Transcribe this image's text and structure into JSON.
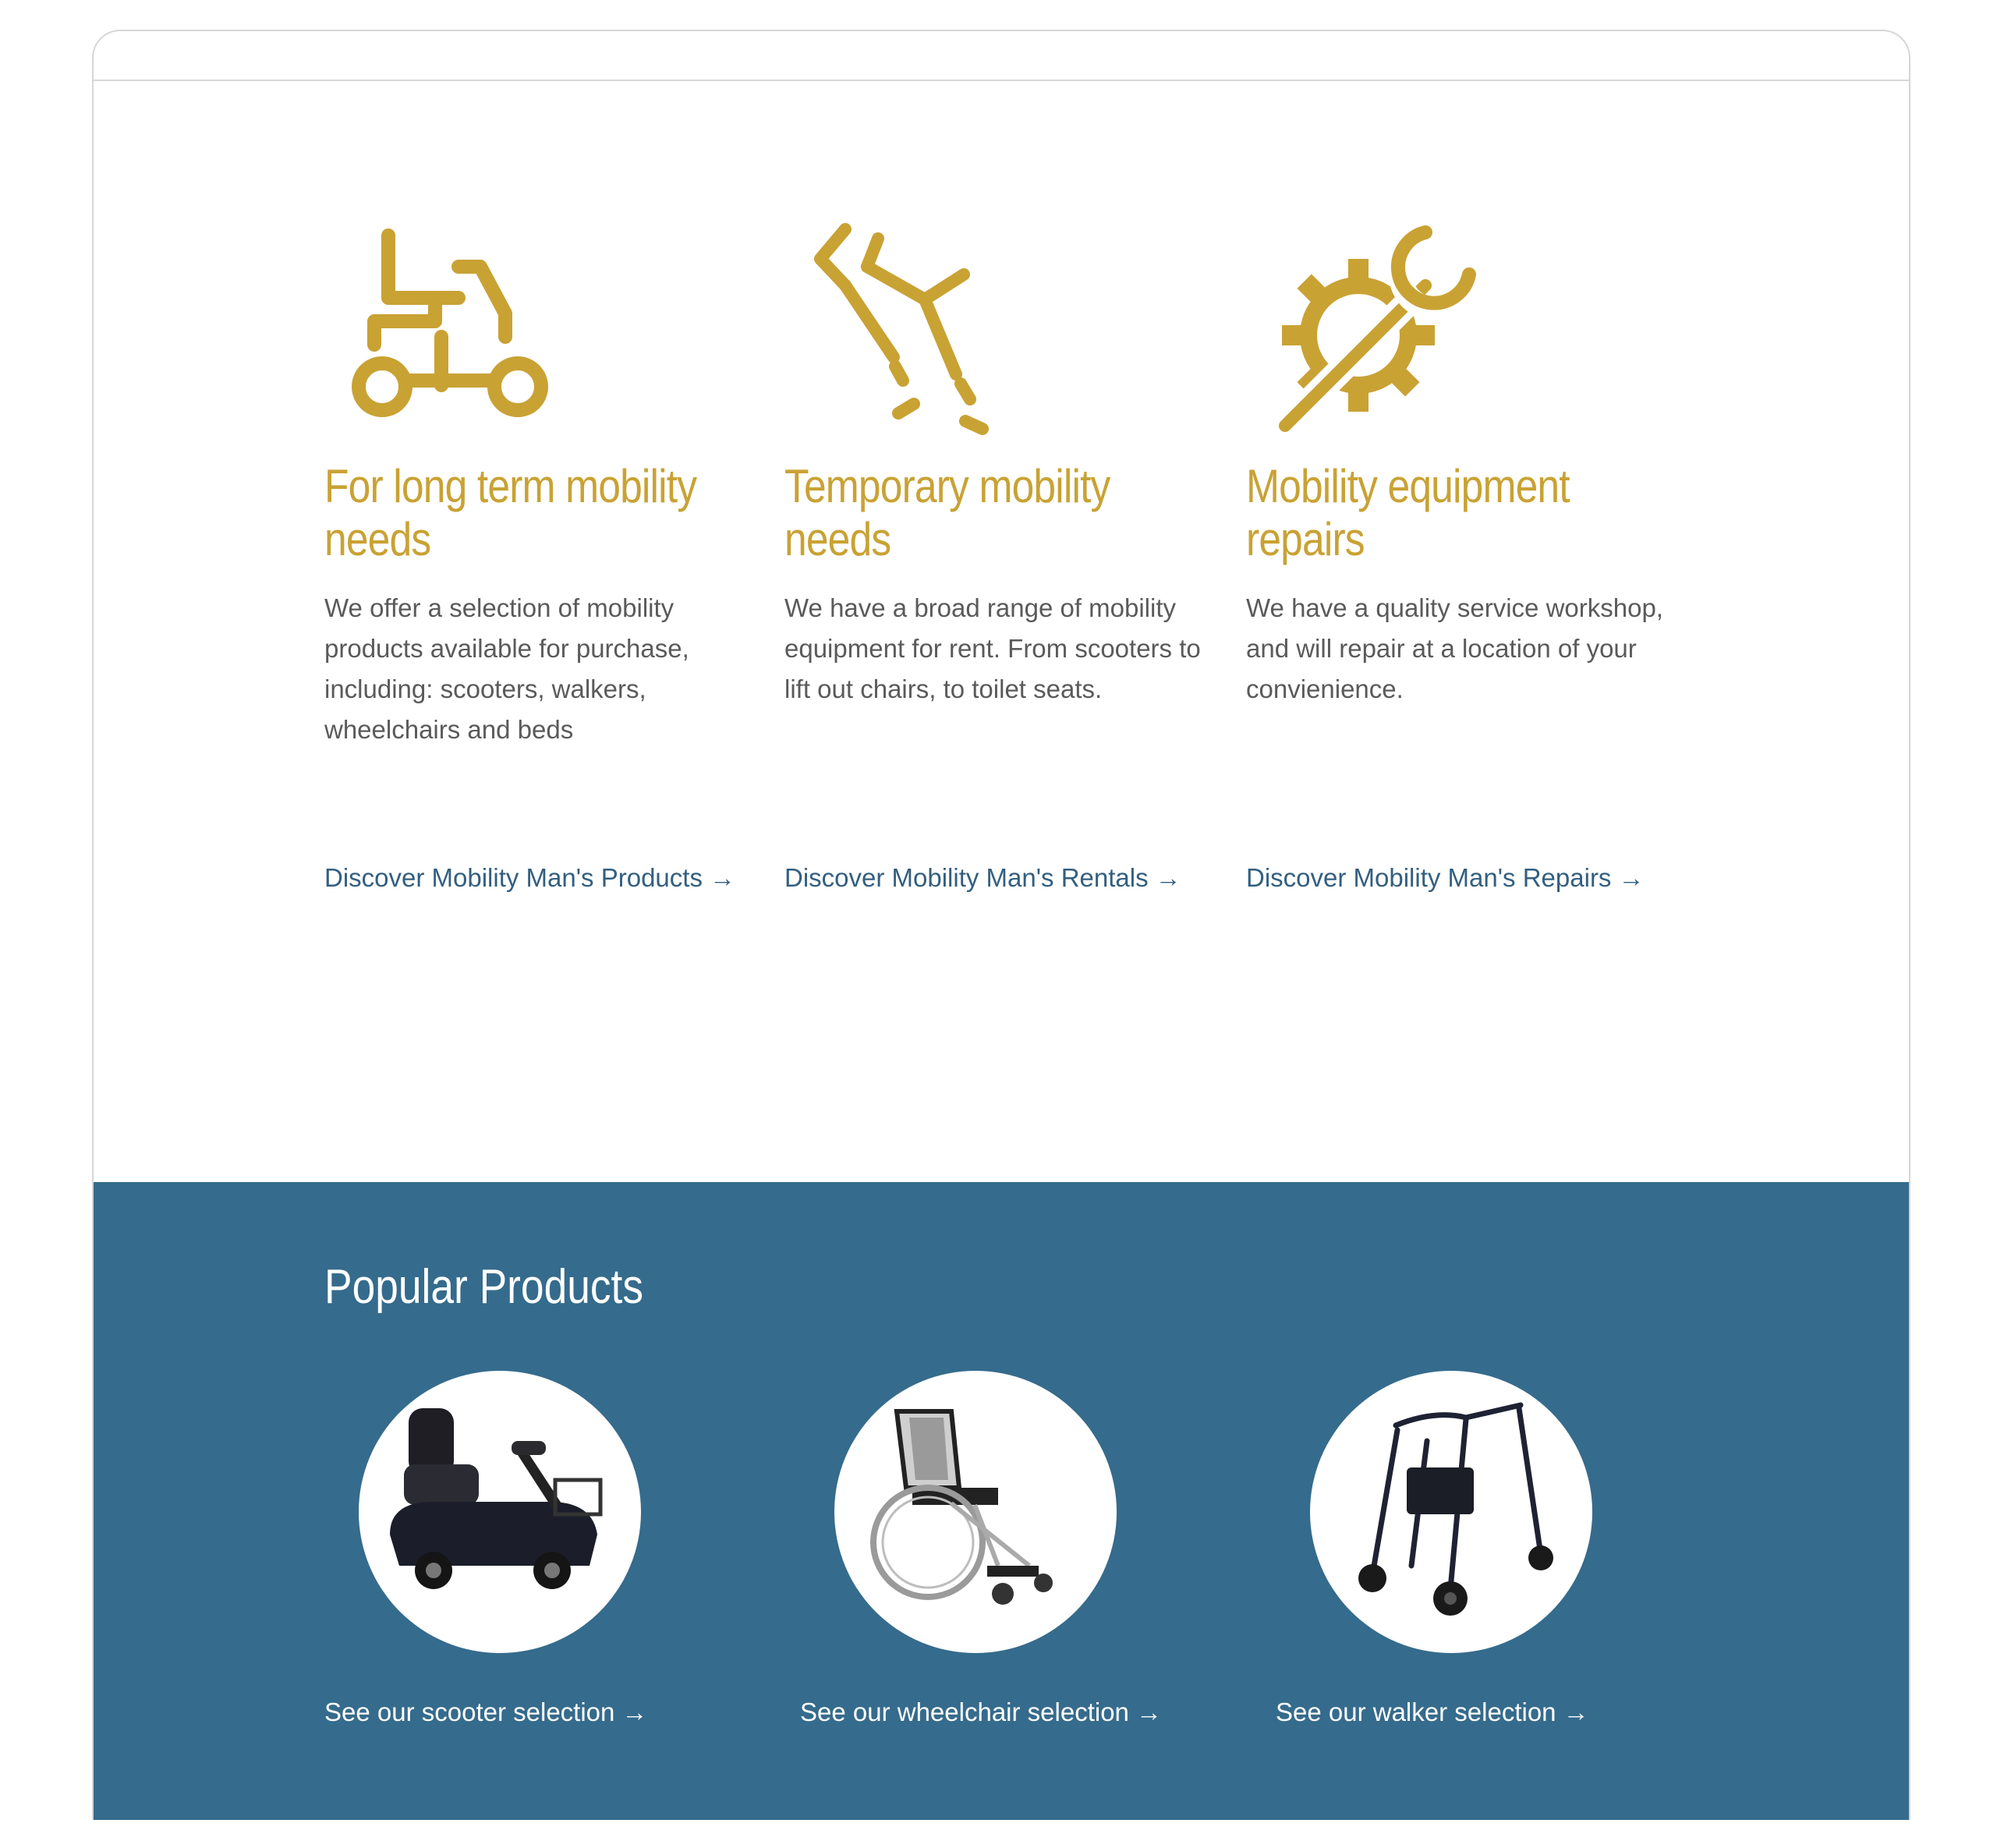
{
  "colors": {
    "gold": "#c9a234",
    "blue": "#356b8c",
    "link": "#335f80"
  },
  "services": [
    {
      "icon": "mobility-scooter-icon",
      "title": "For long term mobility needs",
      "description": "We offer a selection of mobility products available for purchase, including: scooters, walkers, wheelchairs and beds",
      "link": "Discover Mobility Man's Products →"
    },
    {
      "icon": "crutches-icon",
      "title": "Temporary mobility needs",
      "description": "We have a broad range of mobility equipment for rent. From scooters to lift out chairs, to toilet seats.",
      "link": "Discover Mobility Man's Rentals →"
    },
    {
      "icon": "gear-wrench-icon",
      "title": "Mobility equipment repairs",
      "description": "We have a quality service workshop, and will repair at a location of your convienience.",
      "link": "Discover Mobility Man's Repairs →"
    }
  ],
  "popular": {
    "heading": "Popular Products",
    "products": [
      {
        "image": "scooter-image",
        "link": "See our scooter selection →"
      },
      {
        "image": "wheelchair-image",
        "link": "See our wheelchair selection →"
      },
      {
        "image": "walker-image",
        "link": "See our walker selection →"
      }
    ]
  }
}
